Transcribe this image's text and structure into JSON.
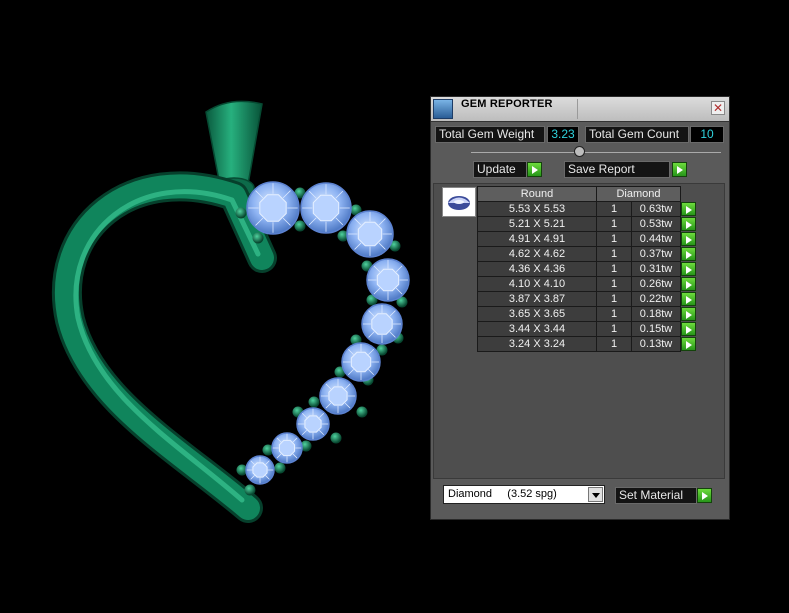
{
  "panel": {
    "title": "GEM REPORTER",
    "close_glyph": "✕",
    "total_gem_weight_label": "Total Gem Weight",
    "total_gem_weight_value": "3.23",
    "total_gem_count_label": "Total Gem Count",
    "total_gem_count_value": "10",
    "update_label": "Update",
    "save_report_label": "Save Report",
    "table": {
      "headers": [
        "Round",
        "Diamond"
      ],
      "rows": [
        {
          "size": "5.53 X 5.53",
          "count": "1",
          "weight": "0.63tw"
        },
        {
          "size": "5.21 X 5.21",
          "count": "1",
          "weight": "0.53tw"
        },
        {
          "size": "4.91 X 4.91",
          "count": "1",
          "weight": "0.44tw"
        },
        {
          "size": "4.62 X 4.62",
          "count": "1",
          "weight": "0.37tw"
        },
        {
          "size": "4.36 X 4.36",
          "count": "1",
          "weight": "0.31tw"
        },
        {
          "size": "4.10 X 4.10",
          "count": "1",
          "weight": "0.26tw"
        },
        {
          "size": "3.87 X 3.87",
          "count": "1",
          "weight": "0.22tw"
        },
        {
          "size": "3.65 X 3.65",
          "count": "1",
          "weight": "0.18tw"
        },
        {
          "size": "3.44 X 3.44",
          "count": "1",
          "weight": "0.15tw"
        },
        {
          "size": "3.24 X 3.24",
          "count": "1",
          "weight": "0.13tw"
        }
      ]
    },
    "material_select": "Diamond     (3.52 spg)",
    "set_material_label": "Set Material"
  },
  "icons": [
    "gem-reporter-app-icon",
    "close-icon",
    "play-arrow-icon",
    "gem-thumbnail-icon",
    "chevron-down-icon"
  ],
  "colors": {
    "metal": "#0f7a55",
    "gem": "#8ab4f5",
    "value_text": "#2fd3dd",
    "go_button": "#3fb82a"
  }
}
